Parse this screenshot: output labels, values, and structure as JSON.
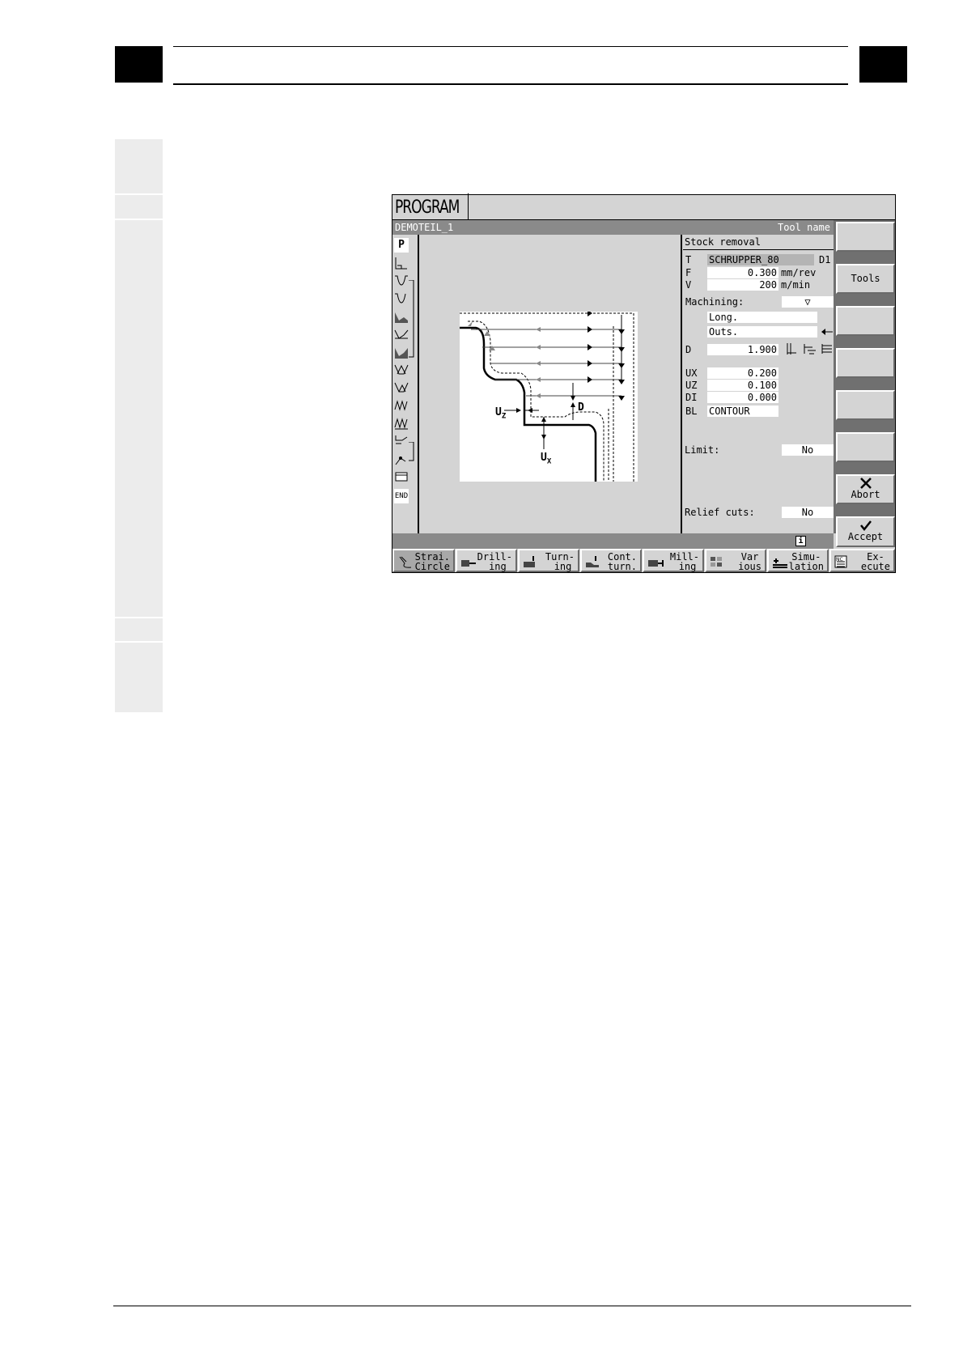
{
  "window_title": "PROGRAM",
  "status": {
    "program_name": "DEMOTEIL_1",
    "field_hint": "Tool name"
  },
  "form": {
    "title": "Stock removal",
    "T": {
      "label": "T",
      "value": "SCHRUPPER_80",
      "suffix": "D1"
    },
    "F": {
      "label": "F",
      "value": "0.300",
      "unit": "mm/rev"
    },
    "V": {
      "label": "V",
      "value": "200",
      "unit": "m/min"
    },
    "machining": {
      "label": "Machining:",
      "value": "▽",
      "mode": "Long.",
      "side": "Outs.",
      "side_icon": "arrow-left"
    },
    "D": {
      "label": "D",
      "value": "1.900"
    },
    "UX": {
      "label": "UX",
      "value": "0.200"
    },
    "UZ": {
      "label": "UZ",
      "value": "0.100"
    },
    "DI": {
      "label": "DI",
      "value": "0.000"
    },
    "BL": {
      "label": "BL",
      "value": "CONTOUR"
    },
    "limit": {
      "label": "Limit:",
      "value": "No"
    },
    "relief": {
      "label": "Relief cuts:",
      "value": "No"
    }
  },
  "graphic_labels": {
    "uz": "U",
    "uz_sub": "Z",
    "d": "D",
    "ux": "U",
    "ux_sub": "X"
  },
  "left_icons": [
    "P",
    "END"
  ],
  "vertical_softkeys": [
    {
      "label": ""
    },
    {
      "label": "Tools"
    },
    {
      "label": ""
    },
    {
      "label": ""
    },
    {
      "label": ""
    },
    {
      "label": ""
    },
    {
      "label": "Abort",
      "icon": "x-icon"
    },
    {
      "label": "Accept",
      "icon": "check-icon"
    }
  ],
  "horizontal_softkeys": [
    {
      "label": "Strai.\nCircle",
      "active": true
    },
    {
      "label": "Drill-\n ing"
    },
    {
      "label": "Turn-\n ing"
    },
    {
      "label": "Cont.\nturn."
    },
    {
      "label": "Mill-\n ing"
    },
    {
      "label": "Var\nious"
    },
    {
      "label": "Simu-\nlation"
    },
    {
      "label": "Ex-\necute"
    }
  ],
  "info_icon": "i"
}
